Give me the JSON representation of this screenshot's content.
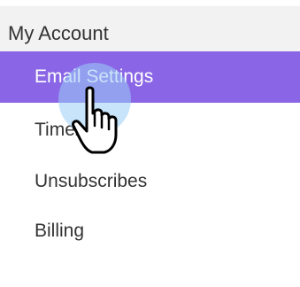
{
  "menu": {
    "header": "My Account",
    "items": [
      {
        "label": "Email Settings",
        "active": true
      },
      {
        "label": "Timezone",
        "active": false
      },
      {
        "label": "Unsubscribes",
        "active": false
      },
      {
        "label": "Billing",
        "active": false
      }
    ]
  },
  "colors": {
    "active_background": "#8a66e6",
    "header_background": "#f2f2f2",
    "text": "#333333",
    "click_highlight": "#9bcdf5"
  },
  "cursor": {
    "icon": "hand-pointer-icon"
  }
}
